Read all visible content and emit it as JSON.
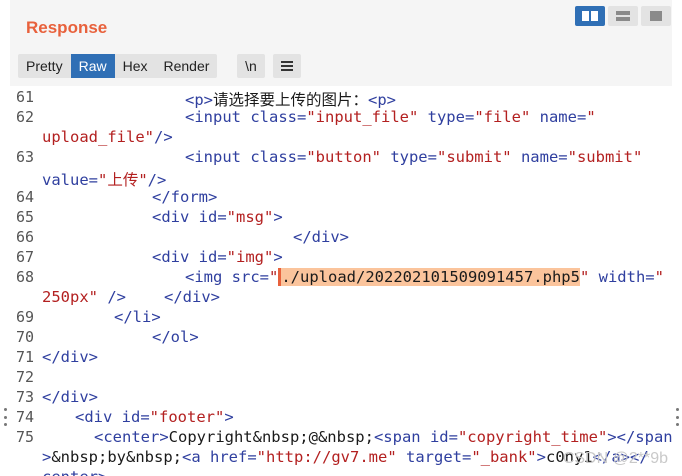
{
  "panel": {
    "title": "Response"
  },
  "tabs": [
    {
      "label": "Pretty",
      "active": false
    },
    {
      "label": "Raw",
      "active": true
    },
    {
      "label": "Hex",
      "active": false
    },
    {
      "label": "Render",
      "active": false
    }
  ],
  "toolbar": {
    "newline_label": "\\n",
    "menu_icon": "hamburger-icon"
  },
  "layout_icons": [
    "split-horizontal-icon",
    "split-vertical-icon",
    "single-pane-icon"
  ],
  "colors": {
    "accent": "#e8613c",
    "active_tab": "#2f6fb5",
    "tag": "#2f3f9f",
    "value": "#b32020",
    "highlight": "#fbc49c"
  },
  "lines": [
    {
      "n": "61",
      "parts": [
        [
          "tag",
          "<p>"
        ],
        [
          "txt",
          "请选择要上传的图片："
        ],
        [
          "tag",
          "<p>"
        ]
      ]
    },
    {
      "n": "62",
      "parts": [
        [
          "tag",
          "<input "
        ],
        [
          "attr",
          "class="
        ],
        [
          "val",
          "\"input_file\""
        ],
        [
          "attr",
          " type="
        ],
        [
          "val",
          "\"file\""
        ],
        [
          "attr",
          " name="
        ],
        [
          "val",
          "\""
        ]
      ]
    },
    {
      "n": "",
      "parts": [
        [
          "val",
          "upload_file\""
        ],
        [
          "tag",
          "/>"
        ]
      ]
    },
    {
      "n": "63",
      "parts": [
        [
          "tag",
          "<input "
        ],
        [
          "attr",
          "class="
        ],
        [
          "val",
          "\"button\""
        ],
        [
          "attr",
          " type="
        ],
        [
          "val",
          "\"submit\""
        ],
        [
          "attr",
          " name="
        ],
        [
          "val",
          "\"submit\""
        ]
      ]
    },
    {
      "n": "",
      "parts": [
        [
          "attr",
          "value="
        ],
        [
          "val",
          "\"上传\""
        ],
        [
          "tag",
          "/>"
        ]
      ]
    },
    {
      "n": "64",
      "parts": [
        [
          "tag",
          "</form>"
        ]
      ]
    },
    {
      "n": "65",
      "parts": [
        [
          "tag",
          "<div "
        ],
        [
          "attr",
          "id="
        ],
        [
          "val",
          "\"msg\""
        ],
        [
          "tag",
          ">"
        ]
      ]
    },
    {
      "n": "66",
      "parts": [
        [
          "tag",
          "</div>"
        ]
      ]
    },
    {
      "n": "67",
      "parts": [
        [
          "tag",
          "<div "
        ],
        [
          "attr",
          "id="
        ],
        [
          "val",
          "\"img\""
        ],
        [
          "tag",
          ">"
        ]
      ]
    },
    {
      "n": "68",
      "parts": [
        [
          "tag",
          "<img "
        ],
        [
          "attr",
          "src="
        ],
        [
          "val",
          "\""
        ],
        [
          "hl",
          "./upload/202202101509091457.php5"
        ],
        [
          "val",
          "\""
        ],
        [
          "attr",
          " width="
        ],
        [
          "val",
          "\""
        ]
      ]
    },
    {
      "n": "",
      "parts": [
        [
          "val",
          "250px\""
        ],
        [
          "tag",
          " />"
        ],
        [
          "tag",
          "</div>"
        ]
      ]
    },
    {
      "n": "69",
      "parts": [
        [
          "tag",
          "</li>"
        ]
      ]
    },
    {
      "n": "70",
      "parts": [
        [
          "tag",
          "</ol>"
        ]
      ]
    },
    {
      "n": "71",
      "parts": [
        [
          "tag",
          "</div>"
        ]
      ]
    },
    {
      "n": "72",
      "parts": []
    },
    {
      "n": "73",
      "parts": [
        [
          "tag",
          "</div>"
        ]
      ]
    },
    {
      "n": "74",
      "parts": [
        [
          "tag",
          "<div "
        ],
        [
          "attr",
          "id="
        ],
        [
          "val",
          "\"footer\""
        ],
        [
          "tag",
          ">"
        ]
      ]
    },
    {
      "n": "75",
      "parts": [
        [
          "tag",
          "<center>"
        ],
        [
          "txt",
          "Copyright&nbsp;@&nbsp;"
        ],
        [
          "tag",
          "<span "
        ],
        [
          "attr",
          "id="
        ],
        [
          "val",
          "\"copyright_time\""
        ],
        [
          "tag",
          "></span"
        ]
      ]
    },
    {
      "n": "",
      "parts": [
        [
          "tag",
          ">"
        ],
        [
          "txt",
          "&nbsp;by&nbsp;"
        ],
        [
          "tag",
          "<a "
        ],
        [
          "attr",
          "href="
        ],
        [
          "val",
          "\"http://gv7.me\""
        ],
        [
          "attr",
          " target="
        ],
        [
          "val",
          "\"_bank\""
        ],
        [
          "tag",
          ">"
        ],
        [
          "txt",
          "c0ny1"
        ],
        [
          "tag",
          "</a></"
        ]
      ]
    },
    {
      "n": "",
      "parts": [
        [
          "tag",
          "center>"
        ]
      ]
    }
  ],
  "watermark": "CSDN @2**9b"
}
